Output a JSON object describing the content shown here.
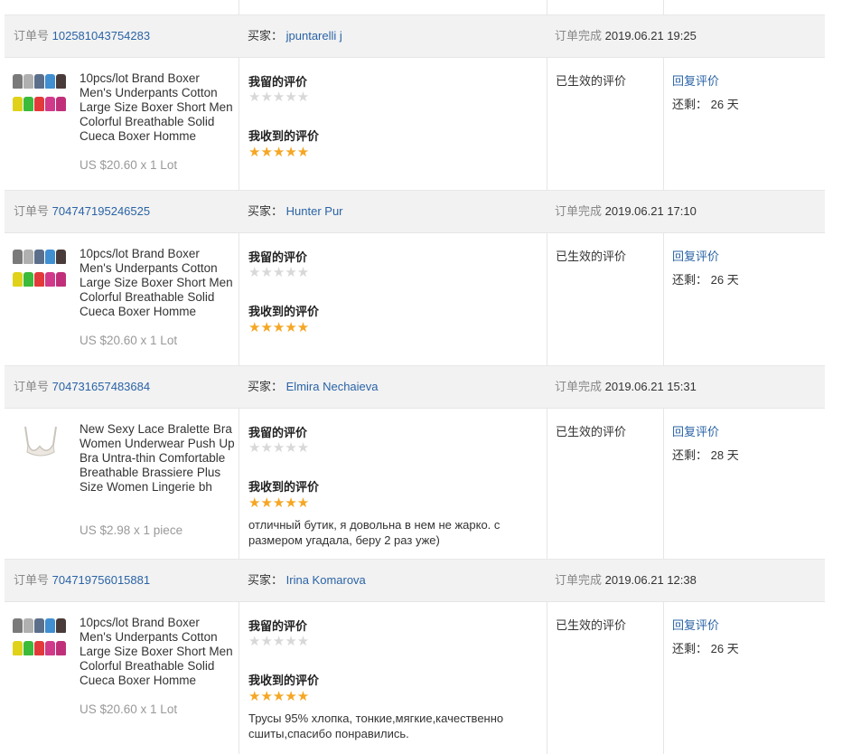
{
  "labels": {
    "order_no": "订单号",
    "buyer": "买家：",
    "completed": "订单完成",
    "my_review": "我留的评价",
    "received_review": "我收到的评价",
    "status": "已生效的评价",
    "reply": "回复评价",
    "remaining_prefix": "还剩：",
    "days": "天",
    "empty_stars": "★★★★★",
    "full_stars": "★★★★★"
  },
  "colors": {
    "link": "#2a63a6",
    "star": "#f5a623",
    "header_bg": "#f2f2f2"
  },
  "orders": [
    {
      "order_id": "102581043754283",
      "buyer": "jpuntarelli j",
      "completed_at": "2019.06.21 19:25",
      "product": "10pcs/lot Brand Boxer Men's Underpants Cotton Large Size Boxer Short Men Colorful Breathable Solid Cueca Boxer Homme",
      "price": "US $20.60 x 1 Lot",
      "remaining_days": "26",
      "comment": "",
      "thumb": "boxers"
    },
    {
      "order_id": "704747195246525",
      "buyer": "Hunter Pur",
      "completed_at": "2019.06.21 17:10",
      "product": "10pcs/lot Brand Boxer Men's Underpants Cotton Large Size Boxer Short Men Colorful Breathable Solid Cueca Boxer Homme",
      "price": "US $20.60 x 1 Lot",
      "remaining_days": "26",
      "comment": "",
      "thumb": "boxers"
    },
    {
      "order_id": "704731657483684",
      "buyer": "Elmira Nechaieva",
      "completed_at": "2019.06.21 15:31",
      "product": "New Sexy Lace Bralette Bra Women Underwear Push Up Bra Untra-thin Comfortable Breathable Brassiere Plus Size Women Lingerie bh",
      "price": "US $2.98 x 1 piece",
      "remaining_days": "28",
      "comment": "отличный бутик, я довольна в нем не жарко. с размером угадала, беру 2 раз уже)",
      "thumb": "bra"
    },
    {
      "order_id": "704719756015881",
      "buyer": "Irina Komarova",
      "completed_at": "2019.06.21 12:38",
      "product": "10pcs/lot Brand Boxer Men's Underpants Cotton Large Size Boxer Short Men Colorful Breathable Solid Cueca Boxer Homme",
      "price": "US $20.60 x 1 Lot",
      "remaining_days": "26",
      "comment": "Трусы 95% хлопка, тонкие,мягкие,качественно сшиты,спасибо понравились.",
      "thumb": "boxers"
    }
  ]
}
